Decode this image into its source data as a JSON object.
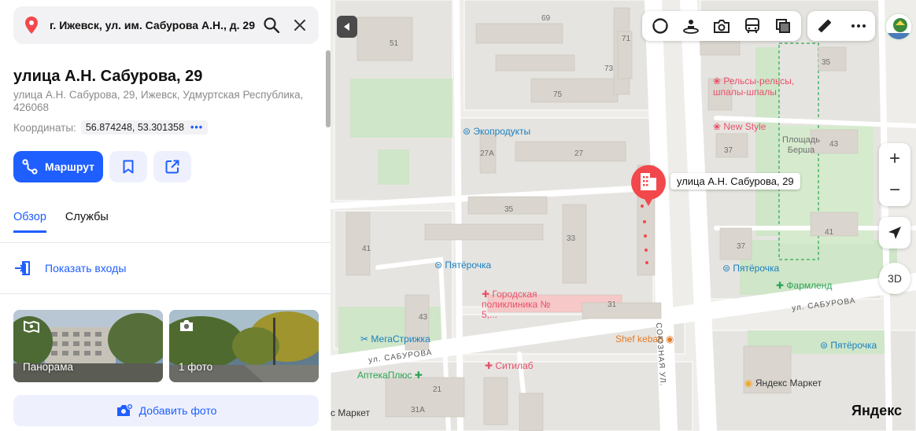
{
  "search": {
    "value": "г. Ижевск, ул. им. Сабурова А.Н., д. 29"
  },
  "place": {
    "title": "улица А.Н. Сабурова, 29",
    "address": "улица А.Н. Сабурова, 29, Ижевск, Удмуртская Республика, 426068",
    "coords_label": "Координаты:",
    "coords_value": "56.874248, 53.301358"
  },
  "actions": {
    "route_label": "Маршрут"
  },
  "tabs": [
    {
      "label": "Обзор",
      "active": true
    },
    {
      "label": "Службы",
      "active": false
    }
  ],
  "entrances_label": "Показать входы",
  "photos": [
    {
      "label": "Панорама"
    },
    {
      "label": "1 фото"
    }
  ],
  "add_photo_label": "Добавить фото",
  "map": {
    "marker_label": "улица А.Н. Сабурова, 29",
    "zoom_in": "+",
    "zoom_out": "−",
    "btn_3d": "3D",
    "logo": "Яндекс",
    "pois": [
      {
        "name": "Экопродукты",
        "color": "#1a7fbf"
      },
      {
        "name": "Пятёрочка",
        "color": "#1a7fbf"
      },
      {
        "name": "Городская поликлиника № 5,...",
        "color": "#e8506a"
      },
      {
        "name": "МегаСтрижка",
        "color": "#1a7fbf"
      },
      {
        "name": "Ситилаб",
        "color": "#e8506a"
      },
      {
        "name": "АптекаПлюс",
        "color": "#2aa355"
      },
      {
        "name": "Shef kebab",
        "color": "#e07b2a"
      },
      {
        "name": "Рельсы-рельсы, шпалы-шпалы",
        "color": "#e8506a"
      },
      {
        "name": "New Style",
        "color": "#e8506a"
      },
      {
        "name": "Пятёрочка",
        "color": "#1a7fbf"
      },
      {
        "name": "Фармленд",
        "color": "#2aa355"
      },
      {
        "name": "Пятёрочка",
        "color": "#1a7fbf"
      },
      {
        "name": "Яндекс Маркет",
        "color": "#333333"
      },
      {
        "name": "с Маркет",
        "color": "#333333"
      }
    ],
    "square": "Площадь Берша",
    "streets": [
      "ул. САБУРОВА",
      "ул. САБУРОВА",
      "СОЮЗНАЯ УЛ."
    ],
    "buildings": [
      "69",
      "71",
      "51",
      "73",
      "75",
      "35",
      "27",
      "27А",
      "33",
      "31",
      "41",
      "43",
      "21",
      "31А",
      "37",
      "37",
      "41",
      "43",
      "35"
    ]
  }
}
